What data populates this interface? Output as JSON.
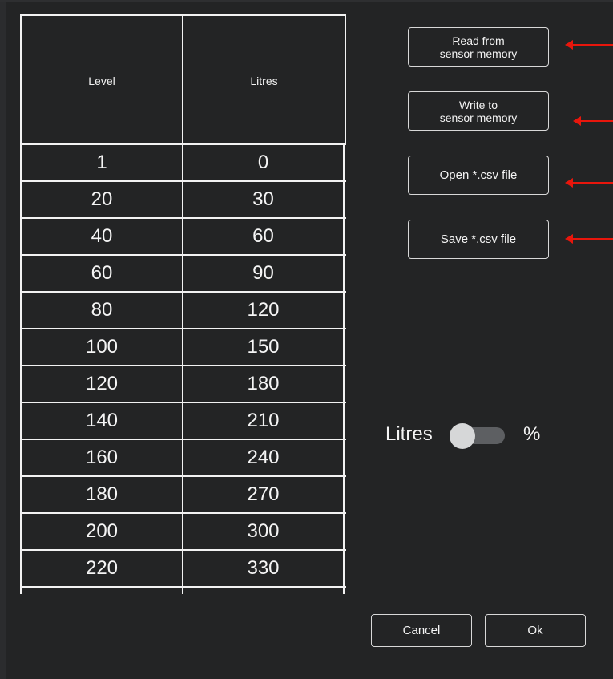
{
  "table": {
    "headers": {
      "level": "Level",
      "litres": "Litres"
    },
    "rows": [
      {
        "level": "1",
        "litres": "0"
      },
      {
        "level": "20",
        "litres": "30"
      },
      {
        "level": "40",
        "litres": "60"
      },
      {
        "level": "60",
        "litres": "90"
      },
      {
        "level": "80",
        "litres": "120"
      },
      {
        "level": "100",
        "litres": "150"
      },
      {
        "level": "120",
        "litres": "180"
      },
      {
        "level": "140",
        "litres": "210"
      },
      {
        "level": "160",
        "litres": "240"
      },
      {
        "level": "180",
        "litres": "270"
      },
      {
        "level": "200",
        "litres": "300"
      },
      {
        "level": "220",
        "litres": "330"
      }
    ]
  },
  "actions": {
    "read_label": "Read from\nsensor memory",
    "write_label": "Write to\nsensor memory",
    "open_label": "Open  *.csv file",
    "save_label": "Save  *.csv file"
  },
  "unit_toggle": {
    "left_label": "Litres",
    "right_label": "%",
    "selected": "Litres"
  },
  "footer": {
    "cancel_label": "Cancel",
    "ok_label": "Ok"
  },
  "annotations": {
    "arrow_color": "#e8160c"
  },
  "colors": {
    "background": "#232425",
    "grid_line": "#f2f2f2",
    "toggle_track": "#5d5f62",
    "toggle_knob": "#d6d7d8"
  }
}
